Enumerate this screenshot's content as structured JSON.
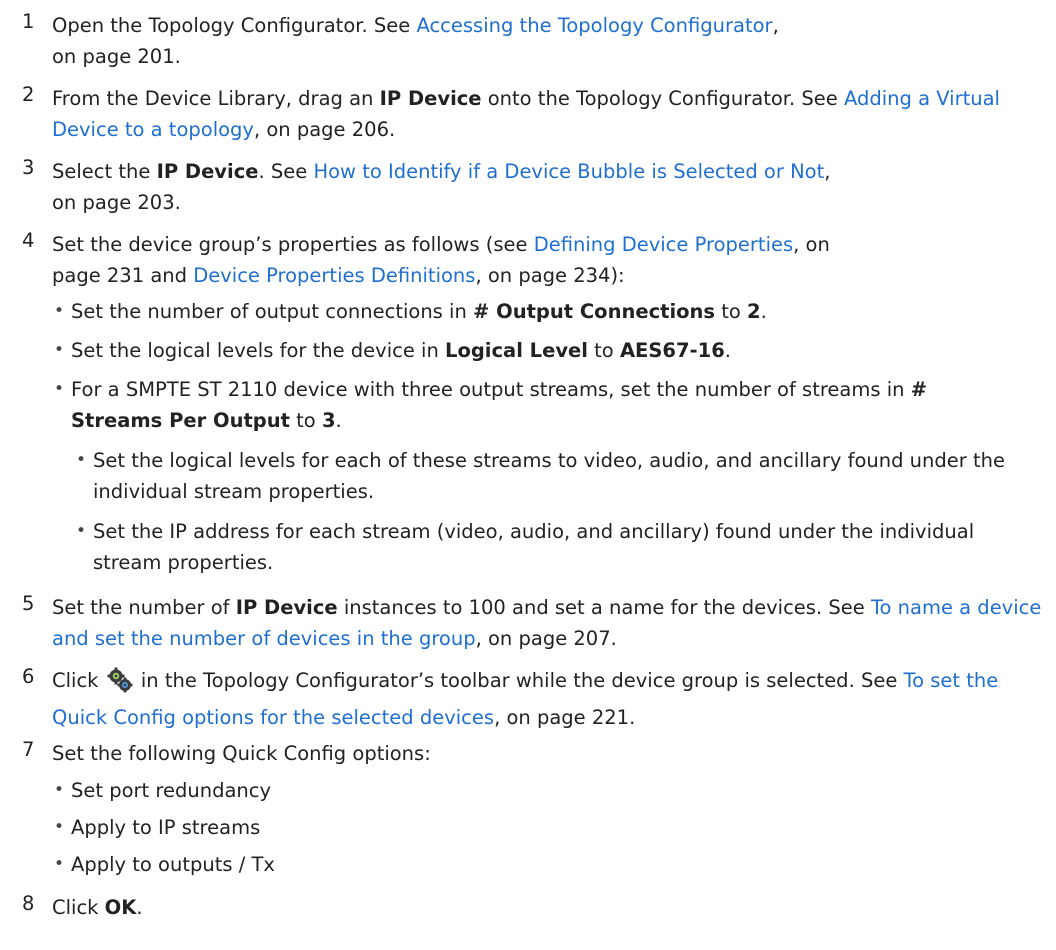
{
  "steps": [
    {
      "num": "1",
      "a": "Open the Topology Configurator. See ",
      "link1": "Accessing the Topology Configurator",
      "b": ", on page 201."
    },
    {
      "num": "2",
      "a": "From the Device Library, drag an ",
      "bold1": "IP Device",
      "b": " onto the Topology Configurator. See ",
      "link1": "Adding a Virtual Device to a topology",
      "c": ", on page 206."
    },
    {
      "num": "3",
      "a": "Select the ",
      "bold1": "IP Device",
      "b": ". See ",
      "link1": "How to Identify if a Device Bubble is Selected or Not",
      "c": ", on page 203."
    },
    {
      "num": "4",
      "a": "Set the device group’s properties as follows (see ",
      "link1": "Defining Device Properties",
      "b": ", on page 231 and ",
      "link2": "Device Properties Definitions",
      "c": ", on page 234):",
      "bullets": [
        {
          "a": "Set the number of output connections in ",
          "bold1": "# Output Connections",
          "b": " to ",
          "bold2": "2",
          "c": "."
        },
        {
          "a": "Set the logical levels for the device in ",
          "bold1": "Logical Level",
          "b": " to ",
          "bold2": "AES67-16",
          "c": "."
        },
        {
          "a": "For a SMPTE ST 2110 device with three output streams, set the number of streams in ",
          "bold1": "# Streams Per Output",
          "b": " to ",
          "bold2": "3",
          "c": "."
        }
      ],
      "subbullets": [
        "Set the logical levels for each of these streams to video, audio, and ancillary found under the individual stream properties.",
        "Set the IP address for each stream (video, audio, and ancillary) found under the individual stream properties."
      ]
    },
    {
      "num": "5",
      "a": "Set the number of ",
      "bold1": "IP Device",
      "b": " instances to 100 and set a name for the devices. See ",
      "link1": "To name a device and set the number of devices in the group",
      "c": ", on page 207."
    },
    {
      "num": "6",
      "a": "Click ",
      "icon": "quick-config-gears-icon",
      "b": " in the Topology Configurator’s toolbar while the device group is selected. See ",
      "link1": "To set the Quick Config options for the selected devices",
      "c": ", on page 221."
    },
    {
      "num": "7",
      "a": "Set the following Quick Config options:",
      "bullets": [
        "Set port redundancy",
        "Apply to IP streams",
        "Apply to outputs / Tx"
      ]
    },
    {
      "num": "8",
      "a": "Click ",
      "bold1": "OK",
      "b": "."
    }
  ],
  "colors": {
    "link": "#1f6fd1",
    "text": "#222222"
  }
}
